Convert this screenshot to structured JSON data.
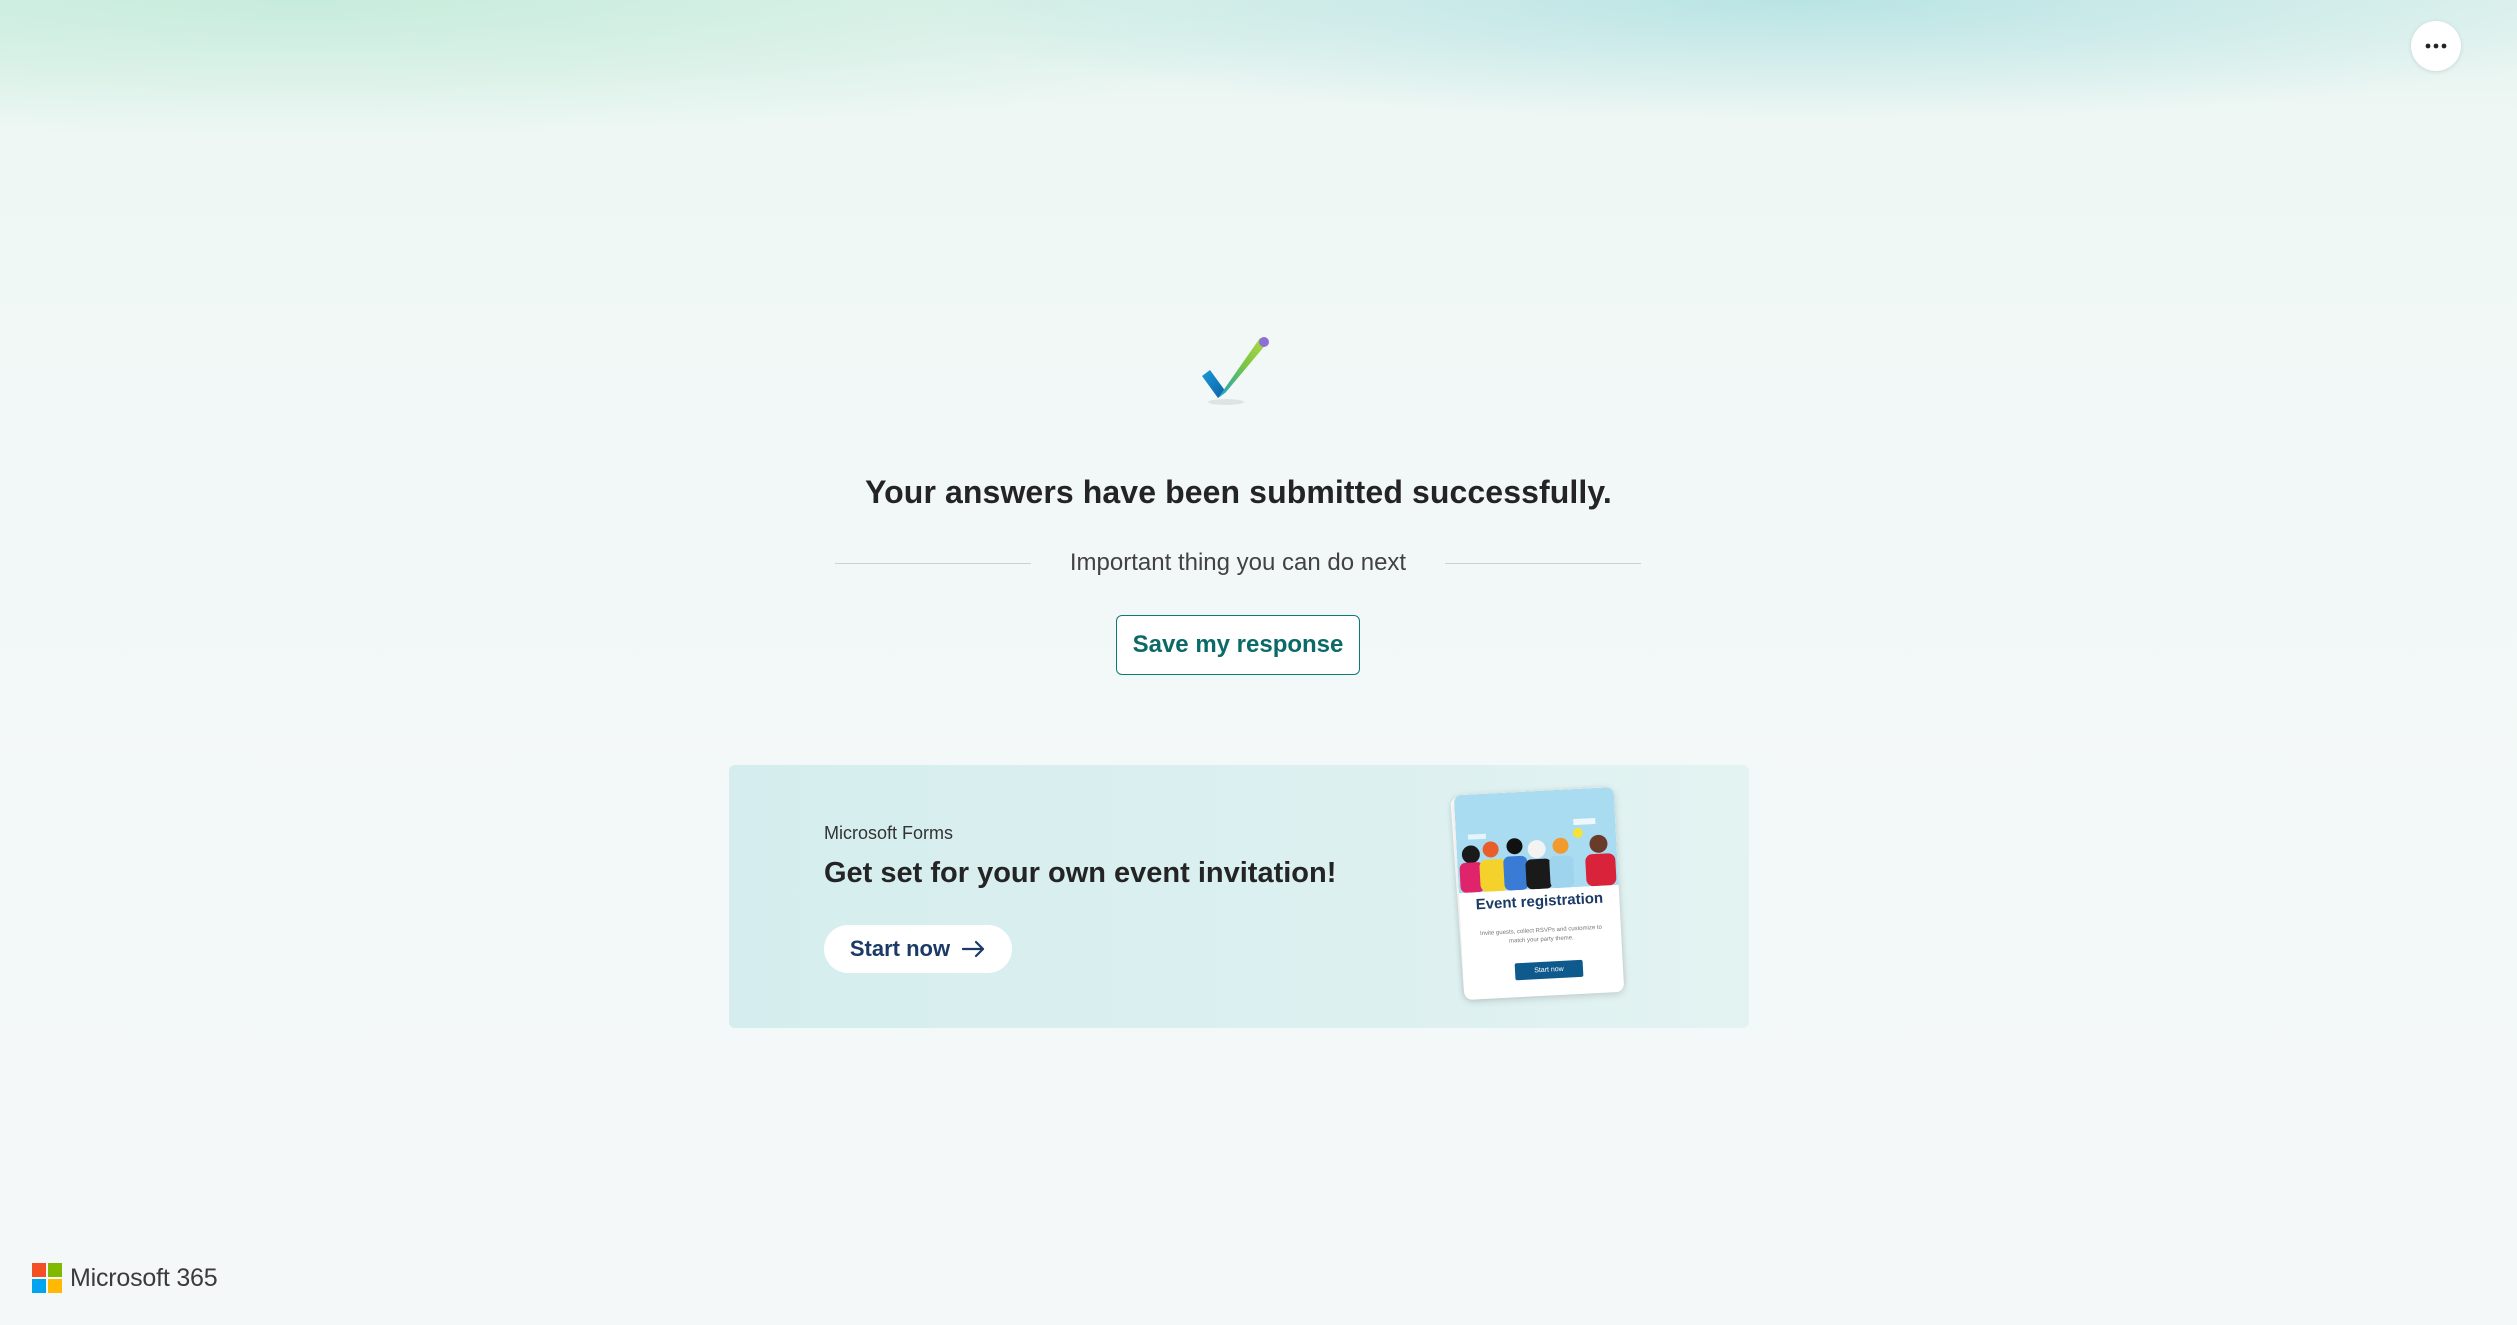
{
  "header": {
    "more_button_icon": "more-horizontal-icon"
  },
  "confirmation": {
    "icon": "checkmark-icon",
    "title": "Your answers have been submitted successfully.",
    "next_label": "Important thing you can do next",
    "save_button_label": "Save my response"
  },
  "promo": {
    "brand": "Microsoft Forms",
    "headline": "Get set for your own event invitation!",
    "start_button_label": "Start now",
    "start_button_icon": "arrow-right-icon",
    "card": {
      "title": "Event registration",
      "description": "Invite guests, collect RSVPs and customize to match your party theme.",
      "button_label": "Start now"
    }
  },
  "footer": {
    "logo_text": "Microsoft 365",
    "logo_colors": [
      "#f25022",
      "#7fba00",
      "#00a4ef",
      "#ffb900"
    ]
  },
  "colors": {
    "accent": "#0e7a78",
    "promo_button_text": "#1b3a66"
  }
}
